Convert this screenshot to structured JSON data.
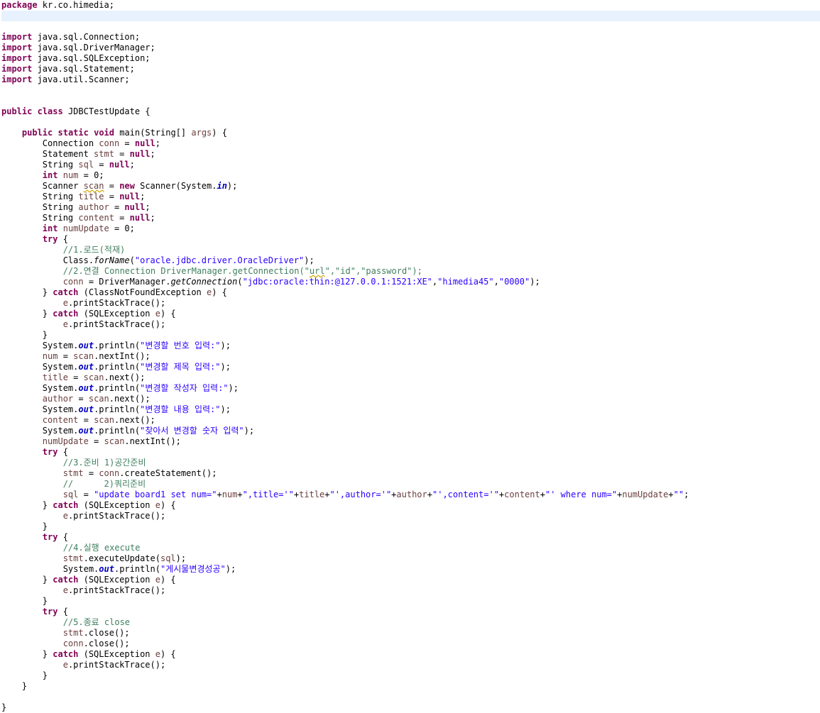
{
  "colors": {
    "keyword": "#7f0055",
    "comment": "#3f7f5f",
    "string": "#2a00ff",
    "static_field": "#0000c0",
    "local_variable": "#6a3e3e",
    "plain": "#000000",
    "current_line": "#e8f2fe",
    "warning_squiggle": "#d4a800"
  },
  "editor": {
    "highlighted_line": 1,
    "lines": [
      [
        {
          "t": "package",
          "c": "kw"
        },
        {
          "t": " kr.co.himedia;"
        }
      ],
      [],
      [],
      [
        {
          "t": "import",
          "c": "kw"
        },
        {
          "t": " java.sql.Connection;"
        }
      ],
      [
        {
          "t": "import",
          "c": "kw"
        },
        {
          "t": " java.sql.DriverManager;"
        }
      ],
      [
        {
          "t": "import",
          "c": "kw"
        },
        {
          "t": " java.sql.SQLException;"
        }
      ],
      [
        {
          "t": "import",
          "c": "kw"
        },
        {
          "t": " java.sql.Statement;"
        }
      ],
      [
        {
          "t": "import",
          "c": "kw"
        },
        {
          "t": " java.util.Scanner;"
        }
      ],
      [],
      [],
      [
        {
          "t": "public",
          "c": "kw"
        },
        {
          "t": " "
        },
        {
          "t": "class",
          "c": "kw"
        },
        {
          "t": " JDBCTestUpdate {"
        }
      ],
      [],
      [
        {
          "t": "    "
        },
        {
          "t": "public",
          "c": "kw"
        },
        {
          "t": " "
        },
        {
          "t": "static",
          "c": "kw"
        },
        {
          "t": " "
        },
        {
          "t": "void",
          "c": "kw"
        },
        {
          "t": " main(String[] "
        },
        {
          "t": "args",
          "c": "va"
        },
        {
          "t": ") {"
        }
      ],
      [
        {
          "t": "        Connection "
        },
        {
          "t": "conn",
          "c": "va"
        },
        {
          "t": " = "
        },
        {
          "t": "null",
          "c": "kw"
        },
        {
          "t": ";"
        }
      ],
      [
        {
          "t": "        Statement "
        },
        {
          "t": "stmt",
          "c": "va"
        },
        {
          "t": " = "
        },
        {
          "t": "null",
          "c": "kw"
        },
        {
          "t": ";"
        }
      ],
      [
        {
          "t": "        String "
        },
        {
          "t": "sql",
          "c": "va"
        },
        {
          "t": " = "
        },
        {
          "t": "null",
          "c": "kw"
        },
        {
          "t": ";"
        }
      ],
      [
        {
          "t": "        "
        },
        {
          "t": "int",
          "c": "kw"
        },
        {
          "t": " "
        },
        {
          "t": "num",
          "c": "va"
        },
        {
          "t": " = 0;"
        }
      ],
      [
        {
          "t": "        Scanner "
        },
        {
          "t": "scan",
          "c": "va sq"
        },
        {
          "t": " = "
        },
        {
          "t": "new",
          "c": "kw"
        },
        {
          "t": " Scanner(System."
        },
        {
          "t": "in",
          "c": "fd"
        },
        {
          "t": ");"
        }
      ],
      [
        {
          "t": "        String "
        },
        {
          "t": "title",
          "c": "va"
        },
        {
          "t": " = "
        },
        {
          "t": "null",
          "c": "kw"
        },
        {
          "t": ";"
        }
      ],
      [
        {
          "t": "        String "
        },
        {
          "t": "author",
          "c": "va"
        },
        {
          "t": " = "
        },
        {
          "t": "null",
          "c": "kw"
        },
        {
          "t": ";"
        }
      ],
      [
        {
          "t": "        String "
        },
        {
          "t": "content",
          "c": "va"
        },
        {
          "t": " = "
        },
        {
          "t": "null",
          "c": "kw"
        },
        {
          "t": ";"
        }
      ],
      [
        {
          "t": "        "
        },
        {
          "t": "int",
          "c": "kw"
        },
        {
          "t": " "
        },
        {
          "t": "numUpdate",
          "c": "va"
        },
        {
          "t": " = 0;"
        }
      ],
      [
        {
          "t": "        "
        },
        {
          "t": "try",
          "c": "kw"
        },
        {
          "t": " {"
        }
      ],
      [
        {
          "t": "            "
        },
        {
          "t": "//1.로드(적재)",
          "c": "cm"
        }
      ],
      [
        {
          "t": "            Class."
        },
        {
          "t": "forName",
          "c": "it"
        },
        {
          "t": "("
        },
        {
          "t": "\"oracle.jdbc.driver.OracleDriver\"",
          "c": "st"
        },
        {
          "t": ");"
        }
      ],
      [
        {
          "t": "            "
        },
        {
          "t": "//2.연결 Connection DriverManager.getConnection(\"",
          "c": "cm"
        },
        {
          "t": "url",
          "c": "cm sq"
        },
        {
          "t": "\",\"id\",\"password\");",
          "c": "cm"
        }
      ],
      [
        {
          "t": "            "
        },
        {
          "t": "conn",
          "c": "va"
        },
        {
          "t": " = DriverManager."
        },
        {
          "t": "getConnection",
          "c": "it"
        },
        {
          "t": "("
        },
        {
          "t": "\"jdbc:oracle:thin:@127.0.0.1:1521:XE\"",
          "c": "st"
        },
        {
          "t": ","
        },
        {
          "t": "\"himedia45\"",
          "c": "st"
        },
        {
          "t": ","
        },
        {
          "t": "\"0000\"",
          "c": "st"
        },
        {
          "t": ");"
        }
      ],
      [
        {
          "t": "        } "
        },
        {
          "t": "catch",
          "c": "kw"
        },
        {
          "t": " (ClassNotFoundException "
        },
        {
          "t": "e",
          "c": "va"
        },
        {
          "t": ") {"
        }
      ],
      [
        {
          "t": "            "
        },
        {
          "t": "e",
          "c": "va"
        },
        {
          "t": ".printStackTrace();"
        }
      ],
      [
        {
          "t": "        } "
        },
        {
          "t": "catch",
          "c": "kw"
        },
        {
          "t": " (SQLException "
        },
        {
          "t": "e",
          "c": "va"
        },
        {
          "t": ") {"
        }
      ],
      [
        {
          "t": "            "
        },
        {
          "t": "e",
          "c": "va"
        },
        {
          "t": ".printStackTrace();"
        }
      ],
      [
        {
          "t": "        }"
        }
      ],
      [
        {
          "t": "        System."
        },
        {
          "t": "out",
          "c": "fd"
        },
        {
          "t": ".println("
        },
        {
          "t": "\"변경할 번호 입력:\"",
          "c": "st"
        },
        {
          "t": ");"
        }
      ],
      [
        {
          "t": "        "
        },
        {
          "t": "num",
          "c": "va"
        },
        {
          "t": " = "
        },
        {
          "t": "scan",
          "c": "va"
        },
        {
          "t": ".nextInt();"
        }
      ],
      [
        {
          "t": "        System."
        },
        {
          "t": "out",
          "c": "fd"
        },
        {
          "t": ".println("
        },
        {
          "t": "\"변경할 제목 입력:\"",
          "c": "st"
        },
        {
          "t": ");"
        }
      ],
      [
        {
          "t": "        "
        },
        {
          "t": "title",
          "c": "va"
        },
        {
          "t": " = "
        },
        {
          "t": "scan",
          "c": "va"
        },
        {
          "t": ".next();"
        }
      ],
      [
        {
          "t": "        System."
        },
        {
          "t": "out",
          "c": "fd"
        },
        {
          "t": ".println("
        },
        {
          "t": "\"변경할 작성자 입력:\"",
          "c": "st"
        },
        {
          "t": ");"
        }
      ],
      [
        {
          "t": "        "
        },
        {
          "t": "author",
          "c": "va"
        },
        {
          "t": " = "
        },
        {
          "t": "scan",
          "c": "va"
        },
        {
          "t": ".next();"
        }
      ],
      [
        {
          "t": "        System."
        },
        {
          "t": "out",
          "c": "fd"
        },
        {
          "t": ".println("
        },
        {
          "t": "\"변경할 내용 입력:\"",
          "c": "st"
        },
        {
          "t": ");"
        }
      ],
      [
        {
          "t": "        "
        },
        {
          "t": "content",
          "c": "va"
        },
        {
          "t": " = "
        },
        {
          "t": "scan",
          "c": "va"
        },
        {
          "t": ".next();"
        }
      ],
      [
        {
          "t": "        System."
        },
        {
          "t": "out",
          "c": "fd"
        },
        {
          "t": ".println("
        },
        {
          "t": "\"찾아서 변경할 숫자 입력\"",
          "c": "st"
        },
        {
          "t": ");"
        }
      ],
      [
        {
          "t": "        "
        },
        {
          "t": "numUpdate",
          "c": "va"
        },
        {
          "t": " = "
        },
        {
          "t": "scan",
          "c": "va"
        },
        {
          "t": ".nextInt();"
        }
      ],
      [
        {
          "t": "        "
        },
        {
          "t": "try",
          "c": "kw"
        },
        {
          "t": " {"
        }
      ],
      [
        {
          "t": "            "
        },
        {
          "t": "//3.준비 1)공간준비",
          "c": "cm"
        }
      ],
      [
        {
          "t": "            "
        },
        {
          "t": "stmt",
          "c": "va"
        },
        {
          "t": " = "
        },
        {
          "t": "conn",
          "c": "va"
        },
        {
          "t": ".createStatement();"
        }
      ],
      [
        {
          "t": "            "
        },
        {
          "t": "//      2)쿼리준비",
          "c": "cm"
        }
      ],
      [
        {
          "t": "            "
        },
        {
          "t": "sql",
          "c": "va"
        },
        {
          "t": " = "
        },
        {
          "t": "\"update board1 set num=\"",
          "c": "st"
        },
        {
          "t": "+"
        },
        {
          "t": "num",
          "c": "va"
        },
        {
          "t": "+"
        },
        {
          "t": "\",title='\"",
          "c": "st"
        },
        {
          "t": "+"
        },
        {
          "t": "title",
          "c": "va"
        },
        {
          "t": "+"
        },
        {
          "t": "\"',author='\"",
          "c": "st"
        },
        {
          "t": "+"
        },
        {
          "t": "author",
          "c": "va"
        },
        {
          "t": "+"
        },
        {
          "t": "\"',content='\"",
          "c": "st"
        },
        {
          "t": "+"
        },
        {
          "t": "content",
          "c": "va"
        },
        {
          "t": "+"
        },
        {
          "t": "\"' where num=\"",
          "c": "st"
        },
        {
          "t": "+"
        },
        {
          "t": "numUpdate",
          "c": "va"
        },
        {
          "t": "+"
        },
        {
          "t": "\"\"",
          "c": "st"
        },
        {
          "t": ";"
        }
      ],
      [
        {
          "t": "        } "
        },
        {
          "t": "catch",
          "c": "kw"
        },
        {
          "t": " (SQLException "
        },
        {
          "t": "e",
          "c": "va"
        },
        {
          "t": ") {"
        }
      ],
      [
        {
          "t": "            "
        },
        {
          "t": "e",
          "c": "va"
        },
        {
          "t": ".printStackTrace();"
        }
      ],
      [
        {
          "t": "        }"
        }
      ],
      [
        {
          "t": "        "
        },
        {
          "t": "try",
          "c": "kw"
        },
        {
          "t": " {"
        }
      ],
      [
        {
          "t": "            "
        },
        {
          "t": "//4.실행 execute",
          "c": "cm"
        }
      ],
      [
        {
          "t": "            "
        },
        {
          "t": "stmt",
          "c": "va"
        },
        {
          "t": ".executeUpdate("
        },
        {
          "t": "sql",
          "c": "va"
        },
        {
          "t": ");"
        }
      ],
      [
        {
          "t": "            System."
        },
        {
          "t": "out",
          "c": "fd"
        },
        {
          "t": ".println("
        },
        {
          "t": "\"게시물변경성공\"",
          "c": "st"
        },
        {
          "t": ");"
        }
      ],
      [
        {
          "t": "        } "
        },
        {
          "t": "catch",
          "c": "kw"
        },
        {
          "t": " (SQLException "
        },
        {
          "t": "e",
          "c": "va"
        },
        {
          "t": ") {"
        }
      ],
      [
        {
          "t": "            "
        },
        {
          "t": "e",
          "c": "va"
        },
        {
          "t": ".printStackTrace();"
        }
      ],
      [
        {
          "t": "        }"
        }
      ],
      [
        {
          "t": "        "
        },
        {
          "t": "try",
          "c": "kw"
        },
        {
          "t": " {"
        }
      ],
      [
        {
          "t": "            "
        },
        {
          "t": "//5.종료 close",
          "c": "cm"
        }
      ],
      [
        {
          "t": "            "
        },
        {
          "t": "stmt",
          "c": "va"
        },
        {
          "t": ".close();"
        }
      ],
      [
        {
          "t": "            "
        },
        {
          "t": "conn",
          "c": "va"
        },
        {
          "t": ".close();"
        }
      ],
      [
        {
          "t": "        } "
        },
        {
          "t": "catch",
          "c": "kw"
        },
        {
          "t": " (SQLException "
        },
        {
          "t": "e",
          "c": "va"
        },
        {
          "t": ") {"
        }
      ],
      [
        {
          "t": "            "
        },
        {
          "t": "e",
          "c": "va"
        },
        {
          "t": ".printStackTrace();"
        }
      ],
      [
        {
          "t": "        }"
        }
      ],
      [
        {
          "t": "    }"
        }
      ],
      [],
      [
        {
          "t": "}"
        }
      ]
    ]
  }
}
